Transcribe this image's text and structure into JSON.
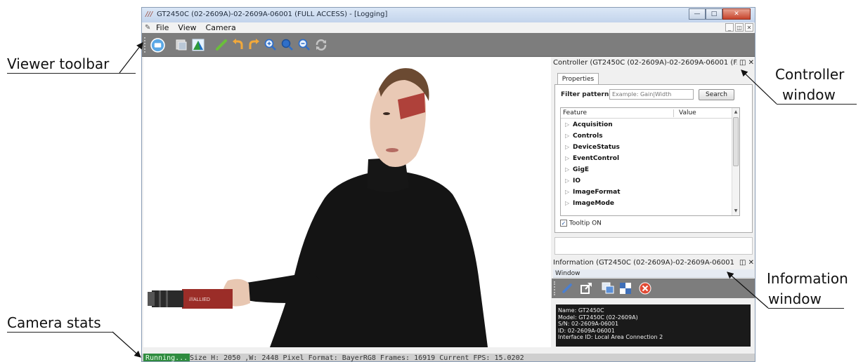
{
  "annotations": {
    "viewer_toolbar": "Viewer toolbar",
    "camera_stats": "Camera stats",
    "controller_window_line1": "Controller",
    "controller_window_line2": "window",
    "information_window_line1": "Information",
    "information_window_line2": "window"
  },
  "window": {
    "title": "GT2450C (02-2609A)-02-2609A-06001 (FULL ACCESS) - [Logging]",
    "min_icon": "minimize-icon",
    "max_icon": "maximize-icon",
    "close_icon": "close-icon"
  },
  "menu": {
    "items": [
      "File",
      "View",
      "Camera"
    ]
  },
  "toolbar": {
    "icons": [
      "freerun-icon",
      "save-image-icon",
      "histogram-icon",
      "edit-icon",
      "rotate-left-icon",
      "rotate-right-icon",
      "zoom-in-icon",
      "zoom-fit-icon",
      "zoom-out-icon",
      "refresh-icon"
    ]
  },
  "viewer": {
    "camera_brand_text": "///ALLIED"
  },
  "controller": {
    "title": "Controller  (GT2450C (02-2609A)-02-2609A-06001 (F...",
    "tab": "Properties",
    "filter_label": "Filter pattern:",
    "filter_placeholder": "Example: Gain|Width",
    "search_label": "Search",
    "col_feature": "Feature",
    "col_value": "Value",
    "features": [
      "Acquisition",
      "Controls",
      "DeviceStatus",
      "EventControl",
      "GigE",
      "IO",
      "ImageFormat",
      "ImageMode"
    ],
    "tooltip_label": "Tooltip ON",
    "tooltip_checked": true
  },
  "information": {
    "title": "Information  (GT2450C (02-2609A)-02-2609A-06001 (...",
    "window_label": "Window",
    "icons": [
      "edit-icon",
      "open-external-icon",
      "copy-windows-icon",
      "color-grid-icon",
      "clear-icon"
    ],
    "lines": [
      "Name: GT2450C",
      "Model: GT2450C (02-2609A)",
      "S/N: 02-2609A-06001",
      "ID: 02-2609A-06001",
      "Interface ID: Local Area Connection 2"
    ]
  },
  "status": {
    "state": "Running...",
    "stats": "Size H: 2050 ,W: 2448  Pixel Format: BayerRG8  Frames: 16919   Current FPS: 15.0202"
  },
  "colors": {
    "toolbar_bg": "#7d7d7d",
    "running_green": "#2f8b3f",
    "info_text_bg": "#1a1a1a"
  }
}
